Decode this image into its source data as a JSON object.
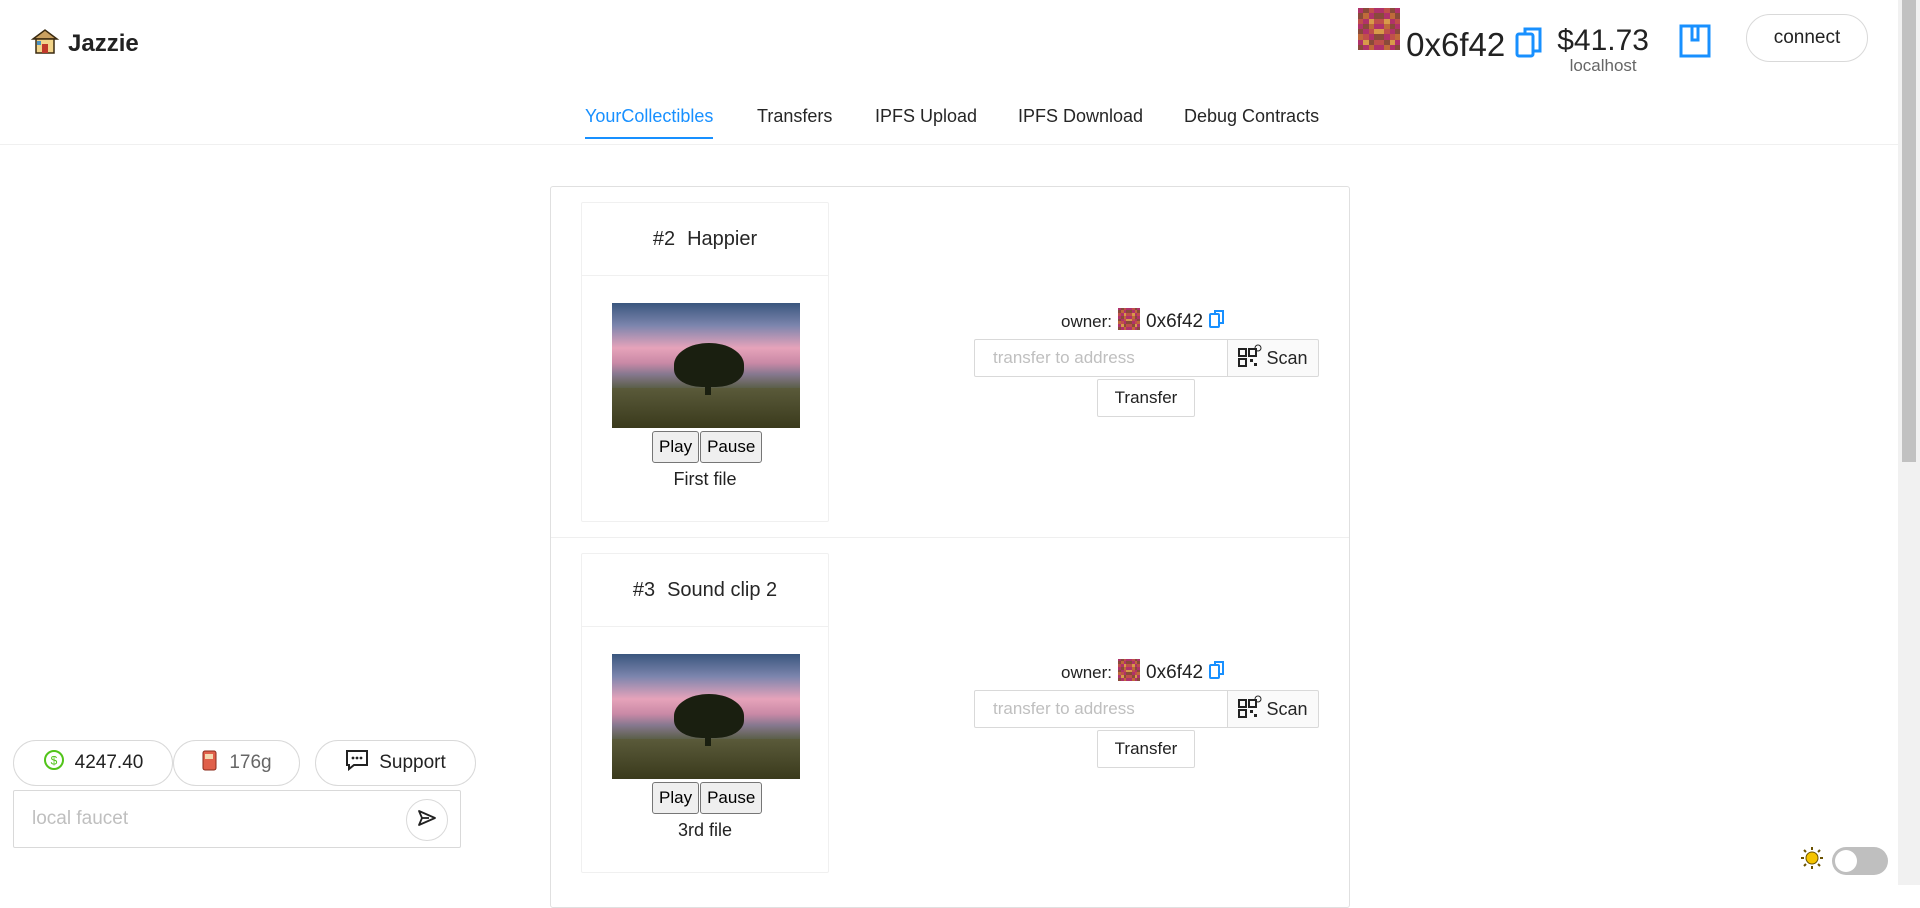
{
  "app": {
    "name": "Jazzie"
  },
  "header": {
    "address": "0x6f42",
    "balance": "$41.73",
    "network": "localhost",
    "connect_label": "connect"
  },
  "tabs": [
    {
      "label": "YourCollectibles",
      "active": true
    },
    {
      "label": "Transfers",
      "active": false
    },
    {
      "label": "IPFS Upload",
      "active": false
    },
    {
      "label": "IPFS Download",
      "active": false
    },
    {
      "label": "Debug Contracts",
      "active": false
    }
  ],
  "collectibles": [
    {
      "id": "#2",
      "name": "Happier",
      "play_label": "Play",
      "pause_label": "Pause",
      "file_label": "First file",
      "owner_label": "owner:",
      "owner_address": "0x6f42",
      "transfer_placeholder": "transfer to address",
      "scan_label": "Scan",
      "transfer_label": "Transfer"
    },
    {
      "id": "#3",
      "name": "Sound clip 2",
      "play_label": "Play",
      "pause_label": "Pause",
      "file_label": "3rd file",
      "owner_label": "owner:",
      "owner_address": "0x6f42",
      "transfer_placeholder": "transfer to address",
      "scan_label": "Scan",
      "transfer_label": "Transfer"
    }
  ],
  "footer": {
    "eth_price": "4247.40",
    "gas_price": "176g",
    "support_label": "Support",
    "faucet_placeholder": "local faucet"
  },
  "colors": {
    "accent": "#1890ff",
    "dollar": "#52c41a",
    "sun": "#f5c400"
  },
  "icons": {
    "logo": "house-icon",
    "copy": "copy-icon",
    "wallet": "wallet-icon",
    "scan": "qrcode-icon",
    "dollar": "dollar-circle-icon",
    "gas": "gas-pump-icon",
    "support": "comment-icon",
    "send": "send-icon",
    "theme": "sun-icon"
  }
}
